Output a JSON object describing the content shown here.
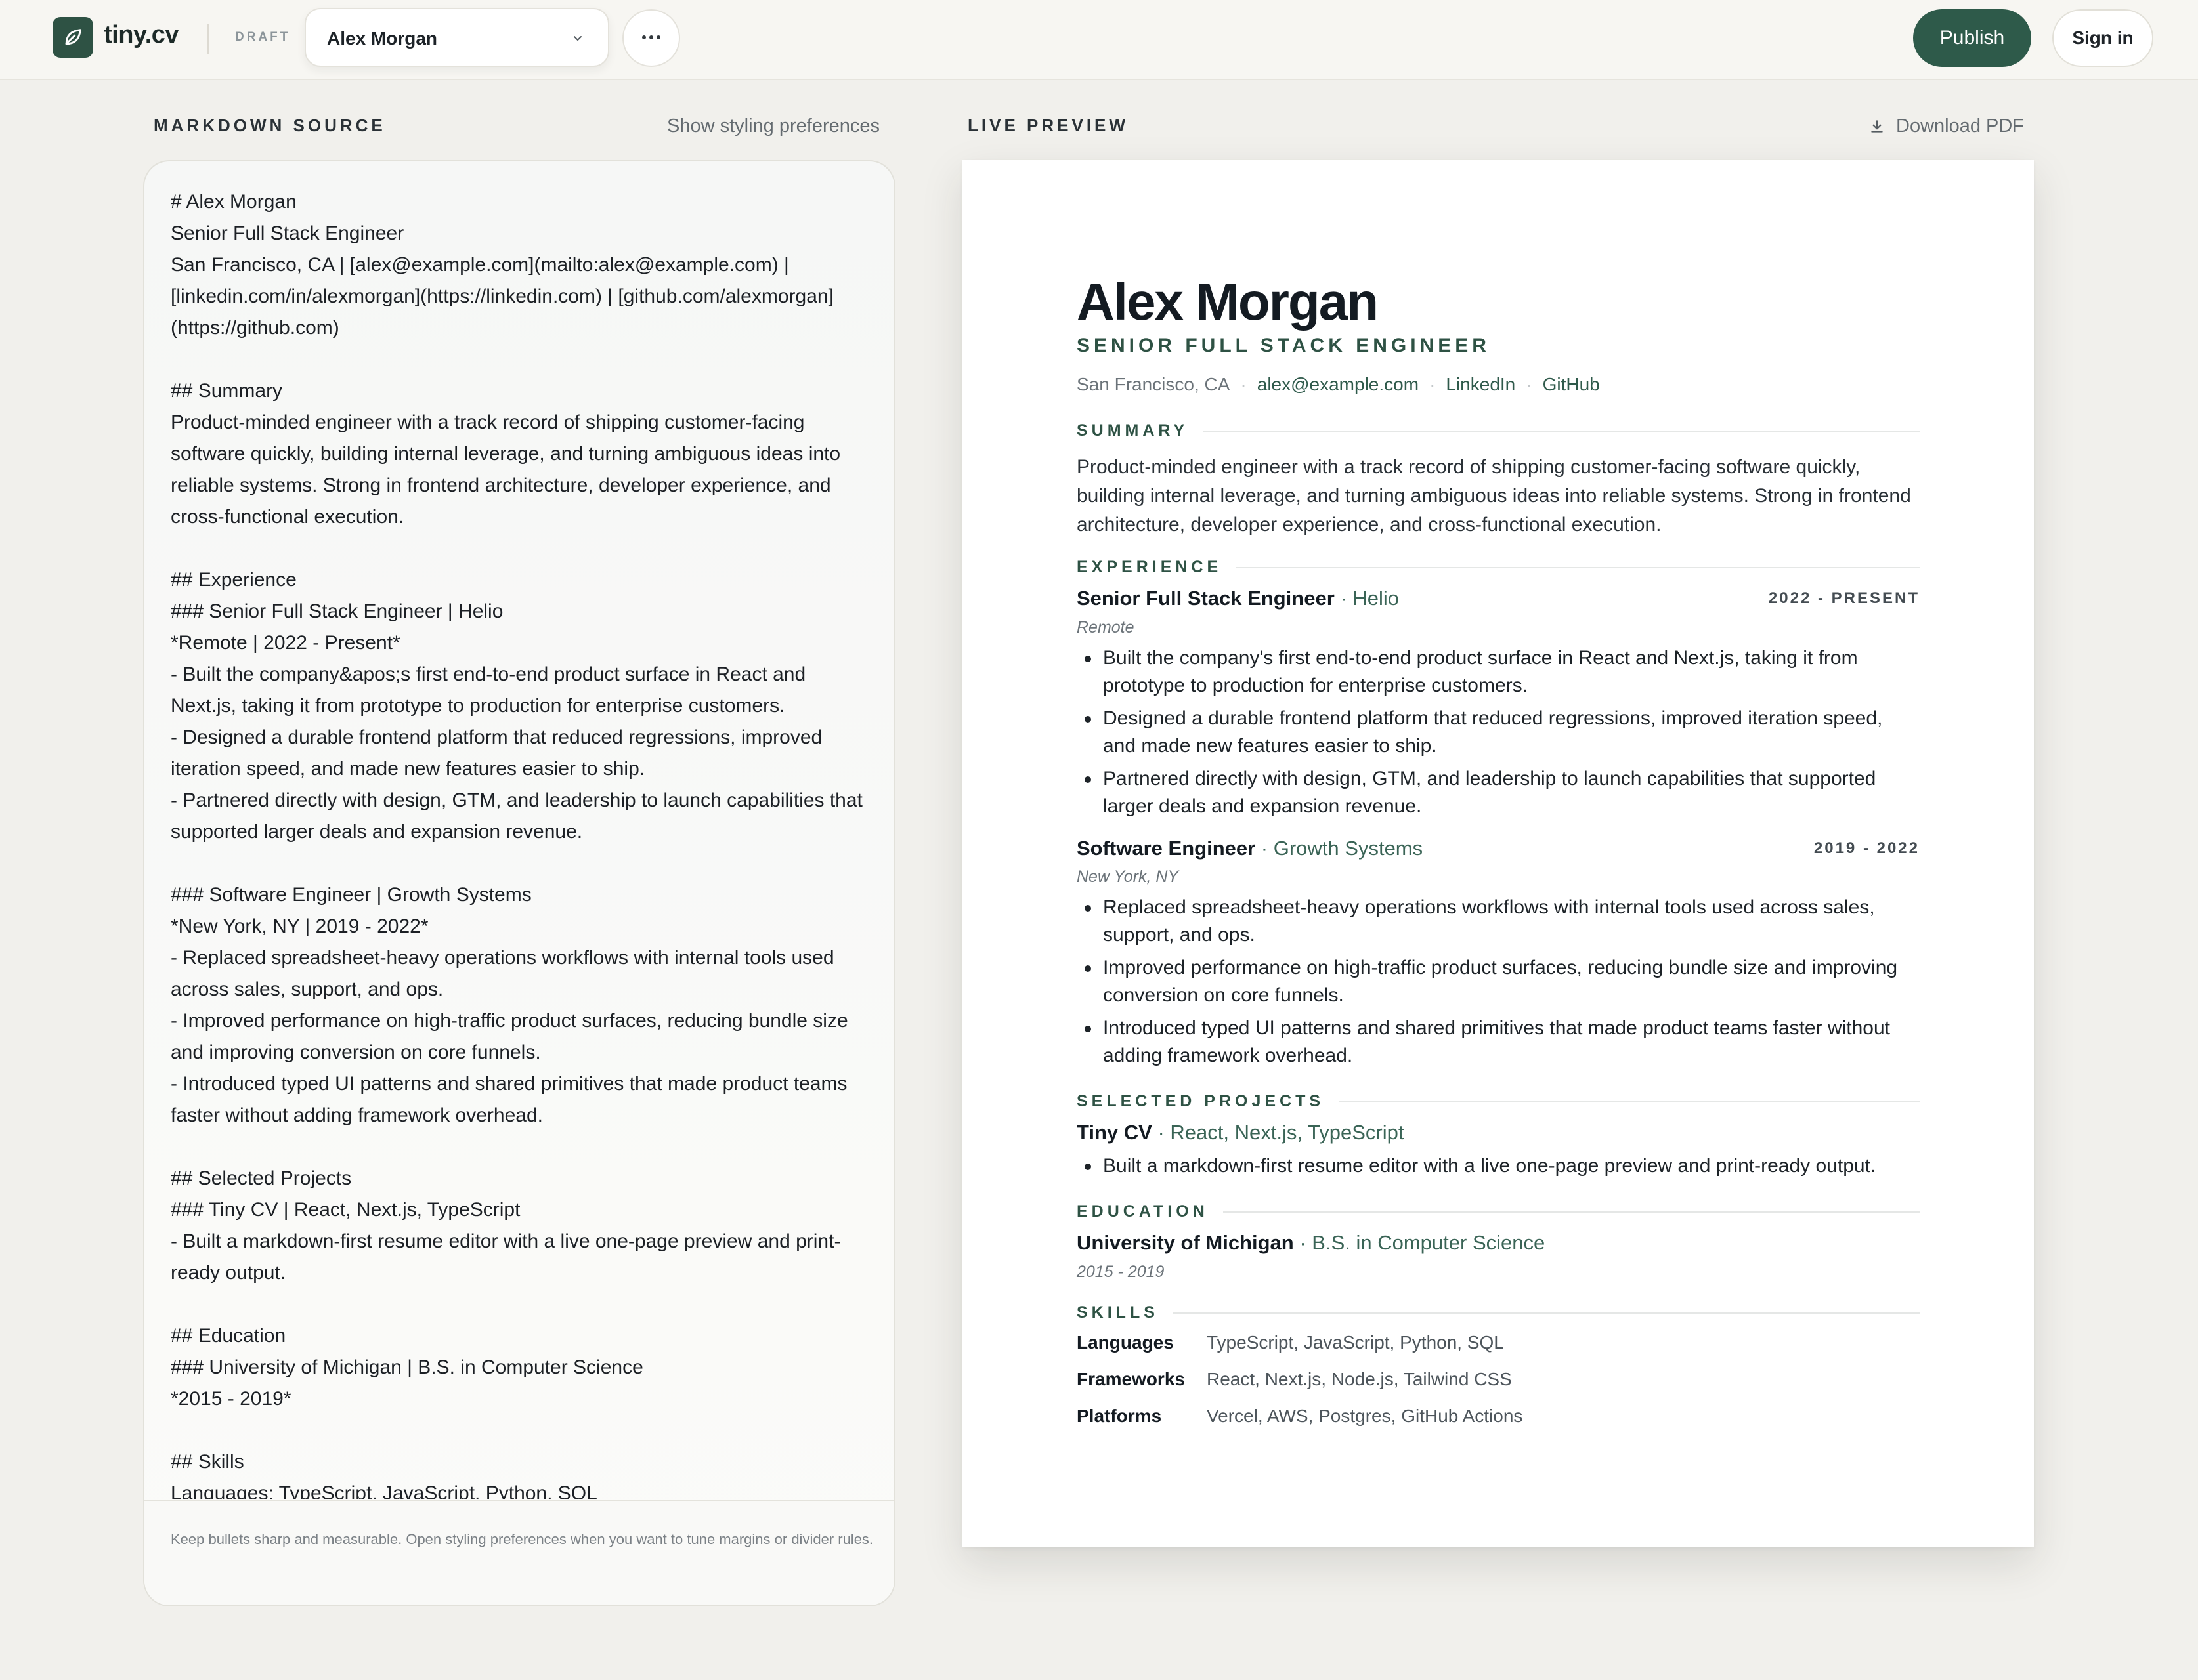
{
  "header": {
    "brand": "tiny.cv",
    "status": "DRAFT",
    "document_name": "Alex Morgan",
    "publish_label": "Publish",
    "signin_label": "Sign in",
    "accent_color": "#2e5a4a"
  },
  "editor": {
    "section_label": "MARKDOWN SOURCE",
    "styling_link": "Show styling preferences",
    "markdown": "# Alex Morgan\nSenior Full Stack Engineer\nSan Francisco, CA | [alex@example.com](mailto:alex@example.com) |\n[linkedin.com/in/alexmorgan](https://linkedin.com) | [github.com/alexmorgan]\n(https://github.com)\n\n## Summary\nProduct-minded engineer with a track record of shipping customer-facing\nsoftware quickly, building internal leverage, and turning ambiguous ideas into\nreliable systems. Strong in frontend architecture, developer experience, and\ncross-functional execution.\n\n## Experience\n### Senior Full Stack Engineer | Helio\n*Remote | 2022 - Present*\n- Built the company&apos;s first end-to-end product surface in React and\nNext.js, taking it from prototype to production for enterprise customers.\n- Designed a durable frontend platform that reduced regressions, improved\niteration speed, and made new features easier to ship.\n- Partnered directly with design, GTM, and leadership to launch capabilities that\nsupported larger deals and expansion revenue.\n\n### Software Engineer | Growth Systems\n*New York, NY | 2019 - 2022*\n- Replaced spreadsheet-heavy operations workflows with internal tools used\nacross sales, support, and ops.\n- Improved performance on high-traffic product surfaces, reducing bundle size\nand improving conversion on core funnels.\n- Introduced typed UI patterns and shared primitives that made product teams\nfaster without adding framework overhead.\n\n## Selected Projects\n### Tiny CV | React, Next.js, TypeScript\n- Built a markdown-first resume editor with a live one-page preview and print-\nready output.\n\n## Education\n### University of Michigan | B.S. in Computer Science\n*2015 - 2019*\n\n## Skills\nLanguages: TypeScript, JavaScript, Python, SQL",
    "footer_tip": "Keep bullets sharp and measurable. Open styling preferences when you want to tune margins or divider rules."
  },
  "preview": {
    "section_label": "LIVE PREVIEW",
    "download_label": "Download PDF",
    "name": "Alex Morgan",
    "title": "SENIOR FULL STACK ENGINEER",
    "contact": {
      "location": "San Francisco, CA",
      "email": "alex@example.com",
      "linkedin": "LinkedIn",
      "github": "GitHub"
    },
    "summary_heading": "SUMMARY",
    "summary": "Product-minded engineer with a track record of shipping customer-facing software quickly, building internal leverage, and turning ambiguous ideas into reliable systems. Strong in frontend architecture, developer experience, and cross-functional execution.",
    "experience_heading": "EXPERIENCE",
    "jobs": [
      {
        "role": "Senior Full Stack Engineer",
        "org": "Helio",
        "dates": "2022 - PRESENT",
        "location": "Remote",
        "bullets": [
          "Built the company's first end-to-end product surface in React and Next.js, taking it from prototype to production for enterprise customers.",
          "Designed a durable frontend platform that reduced regressions, improved iteration speed, and made new features easier to ship.",
          "Partnered directly with design, GTM, and leadership to launch capabilities that supported larger deals and expansion revenue."
        ]
      },
      {
        "role": "Software Engineer",
        "org": "Growth Systems",
        "dates": "2019 - 2022",
        "location": "New York, NY",
        "bullets": [
          "Replaced spreadsheet-heavy operations workflows with internal tools used across sales, support, and ops.",
          "Improved performance on high-traffic product surfaces, reducing bundle size and improving conversion on core funnels.",
          "Introduced typed UI patterns and shared primitives that made product teams faster without adding framework overhead."
        ]
      }
    ],
    "projects_heading": "SELECTED PROJECTS",
    "project": {
      "name": "Tiny CV",
      "stack": "React, Next.js, TypeScript",
      "bullet": "Built a markdown-first resume editor with a live one-page preview and print-ready output."
    },
    "education_heading": "EDUCATION",
    "education": {
      "school": "University of Michigan",
      "degree": "B.S. in Computer Science",
      "dates": "2015 - 2019"
    },
    "skills_heading": "SKILLS",
    "skills": [
      {
        "label": "Languages",
        "value": "TypeScript, JavaScript, Python, SQL"
      },
      {
        "label": "Frameworks",
        "value": "React, Next.js, Node.js, Tailwind CSS"
      },
      {
        "label": "Platforms",
        "value": "Vercel, AWS, Postgres, GitHub Actions"
      }
    ]
  }
}
